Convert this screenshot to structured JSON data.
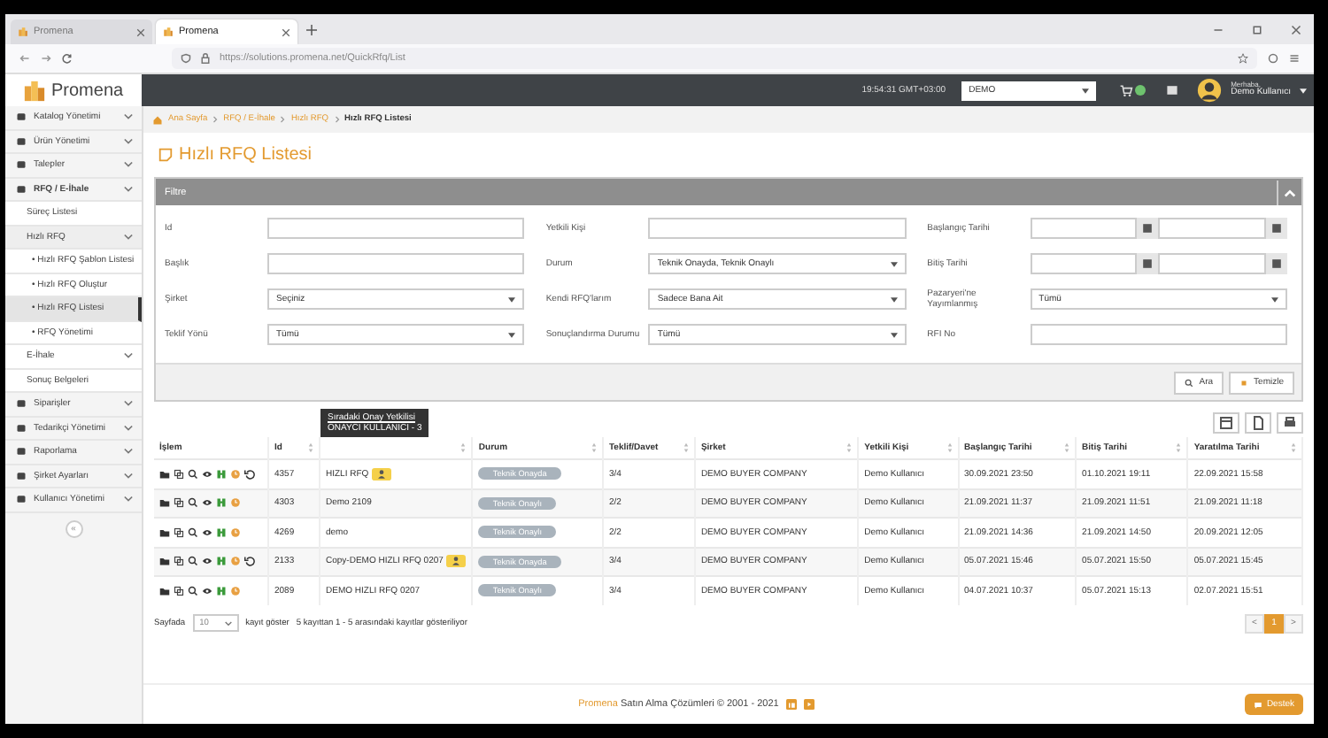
{
  "browser": {
    "tabs": [
      {
        "title": "Promena",
        "selected": false
      },
      {
        "title": "Promena",
        "selected": true
      }
    ],
    "url": "https://solutions.promena.net/QuickRfq/List"
  },
  "header": {
    "logo": "Promena",
    "time": "19:54:31 GMT+03:00",
    "company": "DEMO",
    "greeting": "Merhaba,",
    "user": "Demo Kullanıcı"
  },
  "sidebar": {
    "items": [
      {
        "label": "Katalog Yönetimi",
        "expanded": false,
        "selected": false
      },
      {
        "label": "Ürün Yönetimi",
        "expanded": false,
        "selected": false
      },
      {
        "label": "Talepler",
        "expanded": false,
        "selected": false
      },
      {
        "label": "RFQ / E-İhale",
        "expanded": true,
        "selected": false,
        "children": [
          {
            "label": "Süreç Listesi",
            "selected": false
          },
          {
            "label": "Hızlı RFQ",
            "expanded": true,
            "selected": false,
            "children": [
              {
                "label": "• Hızlı RFQ Şablon Listesi",
                "selected": false
              },
              {
                "label": "• Hızlı RFQ Oluştur",
                "selected": false
              },
              {
                "label": "• Hızlı RFQ Listesi",
                "selected": true
              },
              {
                "label": "• RFQ Yönetimi",
                "selected": false
              }
            ]
          },
          {
            "label": "E-İhale",
            "expanded": false,
            "selected": false
          },
          {
            "label": "Sonuç Belgeleri",
            "selected": false
          }
        ]
      },
      {
        "label": "Siparişler",
        "expanded": false,
        "selected": false
      },
      {
        "label": "Tedarikçi Yönetimi",
        "expanded": false,
        "selected": false
      },
      {
        "label": "Raporlama",
        "expanded": false,
        "selected": false
      },
      {
        "label": "Şirket Ayarları",
        "expanded": false,
        "selected": false
      },
      {
        "label": "Kullanıcı Yönetimi",
        "expanded": false,
        "selected": false
      }
    ],
    "collapse": "«"
  },
  "breadcrumb": [
    "Ana Sayfa",
    "RFQ / E-İhale",
    "Hızlı RFQ",
    "Hızlı RFQ Listesi"
  ],
  "page_title": "Hızlı RFQ Listesi",
  "filter": {
    "title": "Filtre",
    "fields": [
      {
        "label": "Id",
        "kind": "text"
      },
      {
        "label": "Yetkili Kişi",
        "kind": "text"
      },
      {
        "label": "Başlangıç Tarihi",
        "kind": "daterange"
      },
      {
        "label": "Başlık",
        "kind": "text"
      },
      {
        "label": "Durum",
        "kind": "select",
        "value": "Teknik Onayda, Teknik Onaylı"
      },
      {
        "label": "Bitiş Tarihi",
        "kind": "daterange"
      },
      {
        "label": "Şirket",
        "kind": "select",
        "value": "Seçiniz"
      },
      {
        "label": "Kendi RFQ'larım",
        "kind": "select",
        "value": "Sadece Bana Ait"
      },
      {
        "label": "Pazaryeri'ne Yayımlanmış",
        "kind": "select",
        "value": "Tümü"
      },
      {
        "label": "Teklif Yönü",
        "kind": "select",
        "value": "Tümü"
      },
      {
        "label": "Sonuçlandırma Durumu",
        "kind": "select",
        "value": "Tümü"
      },
      {
        "label": "RFI No",
        "kind": "text"
      }
    ],
    "buttons": [
      "Ara",
      "Temizle"
    ]
  },
  "table": {
    "columns": [
      "İşlem",
      "Id",
      "",
      "Durum",
      "Teklif/Davet",
      "Şirket",
      "Yetkili Kişi",
      "Başlangıç Tarihi",
      "Bitiş Tarihi",
      "Yaratılma Tarihi"
    ],
    "tooltip": {
      "title": "Sıradaki Onay Yetkilisi",
      "text": "ONAYCI KULLANICI - 3"
    },
    "rows": [
      {
        "id": "4357",
        "title": "HIZLI RFQ",
        "approver_badge": true,
        "undo": true,
        "status": "Teknik Onayda",
        "offers": "3/4",
        "company": "DEMO BUYER COMPANY",
        "person": "Demo Kullanıcı",
        "start": "30.09.2021 23:50",
        "end": "01.10.2021 19:11",
        "created": "22.09.2021 15:58"
      },
      {
        "id": "4303",
        "title": "Demo 2109",
        "approver_badge": false,
        "undo": false,
        "status": "Teknik Onaylı",
        "offers": "2/2",
        "company": "DEMO BUYER COMPANY",
        "person": "Demo Kullanıcı",
        "start": "21.09.2021 11:37",
        "end": "21.09.2021 11:51",
        "created": "21.09.2021 11:18"
      },
      {
        "id": "4269",
        "title": "demo",
        "approver_badge": false,
        "undo": false,
        "status": "Teknik Onaylı",
        "offers": "2/2",
        "company": "DEMO BUYER COMPANY",
        "person": "Demo Kullanıcı",
        "start": "21.09.2021 14:36",
        "end": "21.09.2021 14:50",
        "created": "20.09.2021 12:05"
      },
      {
        "id": "2133",
        "title": "Copy-DEMO HIZLI RFQ 0207",
        "approver_badge": true,
        "undo": true,
        "status": "Teknik Onayda",
        "offers": "3/4",
        "company": "DEMO BUYER COMPANY",
        "person": "Demo Kullanıcı",
        "start": "05.07.2021 15:46",
        "end": "05.07.2021 15:50",
        "created": "05.07.2021 15:45"
      },
      {
        "id": "2089",
        "title": "DEMO HIZLI RFQ 0207",
        "approver_badge": false,
        "undo": false,
        "status": "Teknik Onaylı",
        "offers": "3/4",
        "company": "DEMO BUYER COMPANY",
        "person": "Demo Kullanıcı",
        "start": "04.07.2021 10:37",
        "end": "05.07.2021 15:13",
        "created": "02.07.2021 15:51"
      }
    ]
  },
  "pagination": {
    "before": "Sayfada",
    "page_size": "10",
    "after": "kayıt göster",
    "info": "5 kayıttan 1 - 5 arasındaki kayıtlar gösteriliyor",
    "prev": "<",
    "pages": [
      {
        "label": "1",
        "selected": true
      }
    ],
    "next": ">"
  },
  "footer": {
    "brand": "Promena",
    "text": "Satın Alma Çözümleri © 2001 - 2021",
    "support": "Destek"
  }
}
